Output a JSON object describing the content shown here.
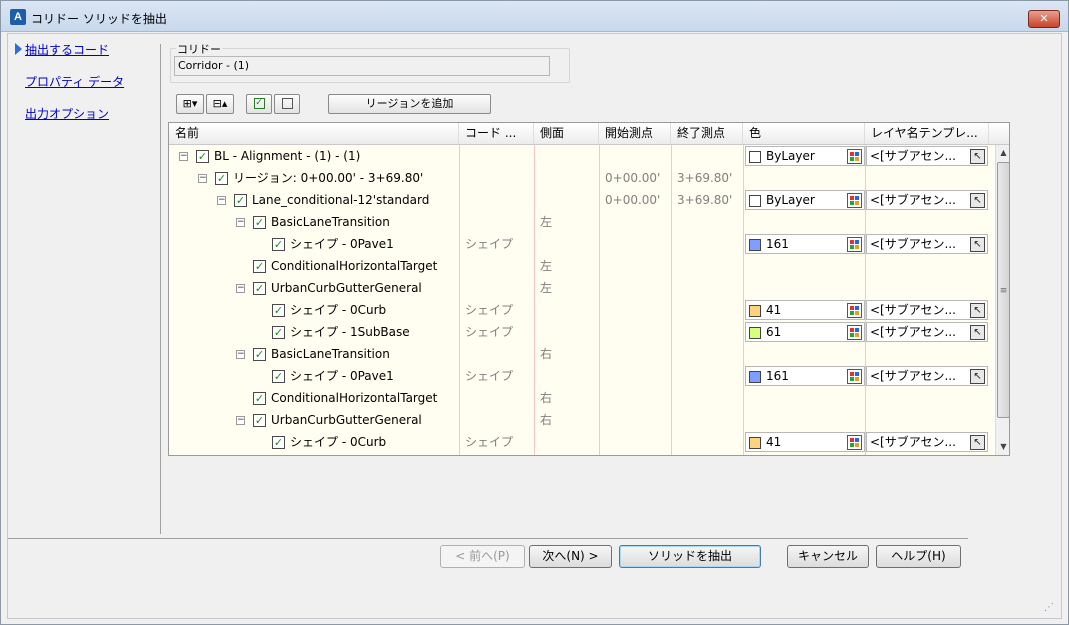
{
  "window": {
    "title": "コリドー ソリッドを抽出",
    "close_label": "✕"
  },
  "nav": {
    "items": [
      {
        "label": "抽出するコード",
        "active": true
      },
      {
        "label": "プロパティ データ",
        "active": false
      },
      {
        "label": "出力オプション",
        "active": false
      }
    ]
  },
  "corridor": {
    "group_label": "コリドー",
    "value": "Corridor - (1)"
  },
  "toolbar": {
    "add_region_label": "リージョンを追加"
  },
  "grid": {
    "columns": [
      "名前",
      "コード ...",
      "側面",
      "開始測点",
      "終了測点",
      "色",
      "レイヤ名テンプレ..."
    ],
    "rows": [
      {
        "name": "BL - Alignment - (1) - (1)",
        "code": "",
        "side": "",
        "start": "",
        "end": "",
        "color": "ByLayer",
        "layer": "<[サブアセン..."
      },
      {
        "name": "リージョン: 0+00.00' - 3+69.80'",
        "code": "",
        "side": "",
        "start": "0+00.00'",
        "end": "3+69.80'",
        "color": "",
        "layer": ""
      },
      {
        "name": "Lane_conditional-12'standard",
        "code": "",
        "side": "",
        "start": "0+00.00'",
        "end": "3+69.80'",
        "color": "ByLayer",
        "layer": "<[サブアセン..."
      },
      {
        "name": "BasicLaneTransition",
        "code": "",
        "side": "左",
        "start": "",
        "end": "",
        "color": "",
        "layer": ""
      },
      {
        "name": "シェイプ - 0Pave1",
        "code": "シェイプ",
        "side": "",
        "start": "",
        "end": "",
        "color": "161",
        "layer": "<[サブアセン..."
      },
      {
        "name": "ConditionalHorizontalTarget",
        "code": "",
        "side": "左",
        "start": "",
        "end": "",
        "color": "",
        "layer": ""
      },
      {
        "name": "UrbanCurbGutterGeneral",
        "code": "",
        "side": "左",
        "start": "",
        "end": "",
        "color": "",
        "layer": ""
      },
      {
        "name": "シェイプ - 0Curb",
        "code": "シェイプ",
        "side": "",
        "start": "",
        "end": "",
        "color": "41",
        "layer": "<[サブアセン..."
      },
      {
        "name": "シェイプ - 1SubBase",
        "code": "シェイプ",
        "side": "",
        "start": "",
        "end": "",
        "color": "61",
        "layer": "<[サブアセン..."
      },
      {
        "name": "BasicLaneTransition",
        "code": "",
        "side": "右",
        "start": "",
        "end": "",
        "color": "",
        "layer": ""
      },
      {
        "name": "シェイプ - 0Pave1",
        "code": "シェイプ",
        "side": "",
        "start": "",
        "end": "",
        "color": "161",
        "layer": "<[サブアセン..."
      },
      {
        "name": "ConditionalHorizontalTarget",
        "code": "",
        "side": "右",
        "start": "",
        "end": "",
        "color": "",
        "layer": ""
      },
      {
        "name": "UrbanCurbGutterGeneral",
        "code": "",
        "side": "右",
        "start": "",
        "end": "",
        "color": "",
        "layer": ""
      },
      {
        "name": "シェイプ - 0Curb",
        "code": "シェイプ",
        "side": "",
        "start": "",
        "end": "",
        "color": "41",
        "layer": "<[サブアセン..."
      }
    ],
    "swatch_colors": {
      "ByLayer": "#ffffff",
      "161": "#7f9fff",
      "41": "#ffd27f",
      "61": "#d4ff7f"
    }
  },
  "buttons": {
    "prev": "< 前へ(P)",
    "next": "次へ(N) >",
    "extract": "ソリッドを抽出",
    "cancel": "キャンセル",
    "help": "ヘルプ(H)"
  }
}
